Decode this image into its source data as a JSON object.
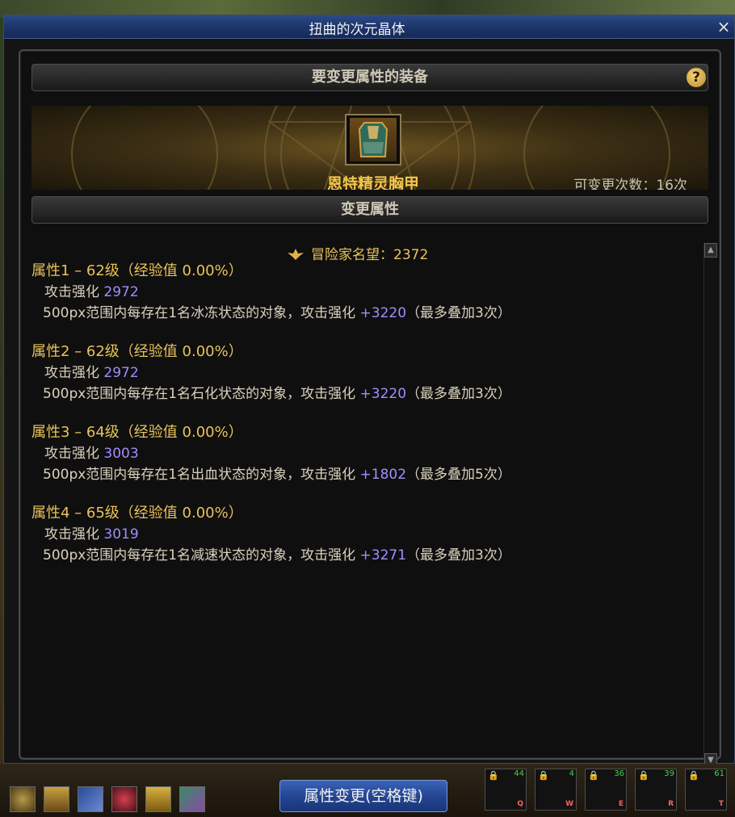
{
  "window": {
    "title": "扭曲的次元晶体",
    "close_glyph": "×"
  },
  "equipment_section": {
    "header": "要变更属性的装备",
    "help_glyph": "?",
    "item_name": "恩特精灵胸甲",
    "change_count": "可变更次数：16次"
  },
  "attribute_section": {
    "header": "变更属性",
    "fame": "冒险家名望：2372",
    "attributes": [
      {
        "title": "属性1 – 62级（经验值 0.00%）",
        "stat_label": "攻击强化",
        "stat_value": "2972",
        "desc_prefix": "500px范围内每存在1名冰冻状态的对象，攻击强化",
        "desc_bonus": "+3220",
        "desc_suffix": "（最多叠加3次）"
      },
      {
        "title": "属性2 – 62级（经验值 0.00%）",
        "stat_label": "攻击强化",
        "stat_value": "2972",
        "desc_prefix": "500px范围内每存在1名石化状态的对象，攻击强化",
        "desc_bonus": "+3220",
        "desc_suffix": "（最多叠加3次）"
      },
      {
        "title": "属性3 – 64级（经验值 0.00%）",
        "stat_label": "攻击强化",
        "stat_value": "3003",
        "desc_prefix": "500px范围内每存在1名出血状态的对象，攻击强化",
        "desc_bonus": "+1802",
        "desc_suffix": "（最多叠加5次）"
      },
      {
        "title": "属性4 – 65级（经验值 0.00%）",
        "stat_label": "攻击强化",
        "stat_value": "3019",
        "desc_prefix": "500px范围内每存在1名减速状态的对象，攻击强化",
        "desc_bonus": "+3271",
        "desc_suffix": "（最多叠加3次）"
      }
    ]
  },
  "bottom_bar": {
    "change_button": "属性变更(空格键)",
    "skills": [
      {
        "level": "44",
        "key": "Q"
      },
      {
        "level": "4",
        "key": "W"
      },
      {
        "level": "36",
        "key": "E"
      },
      {
        "level": "39",
        "key": "R"
      },
      {
        "level": "61",
        "key": "T"
      }
    ]
  },
  "colors": {
    "title_bar": "#1c3468",
    "gold_text": "#e9c35a",
    "purple_value": "#a58bff",
    "button_blue": "#23448f"
  }
}
